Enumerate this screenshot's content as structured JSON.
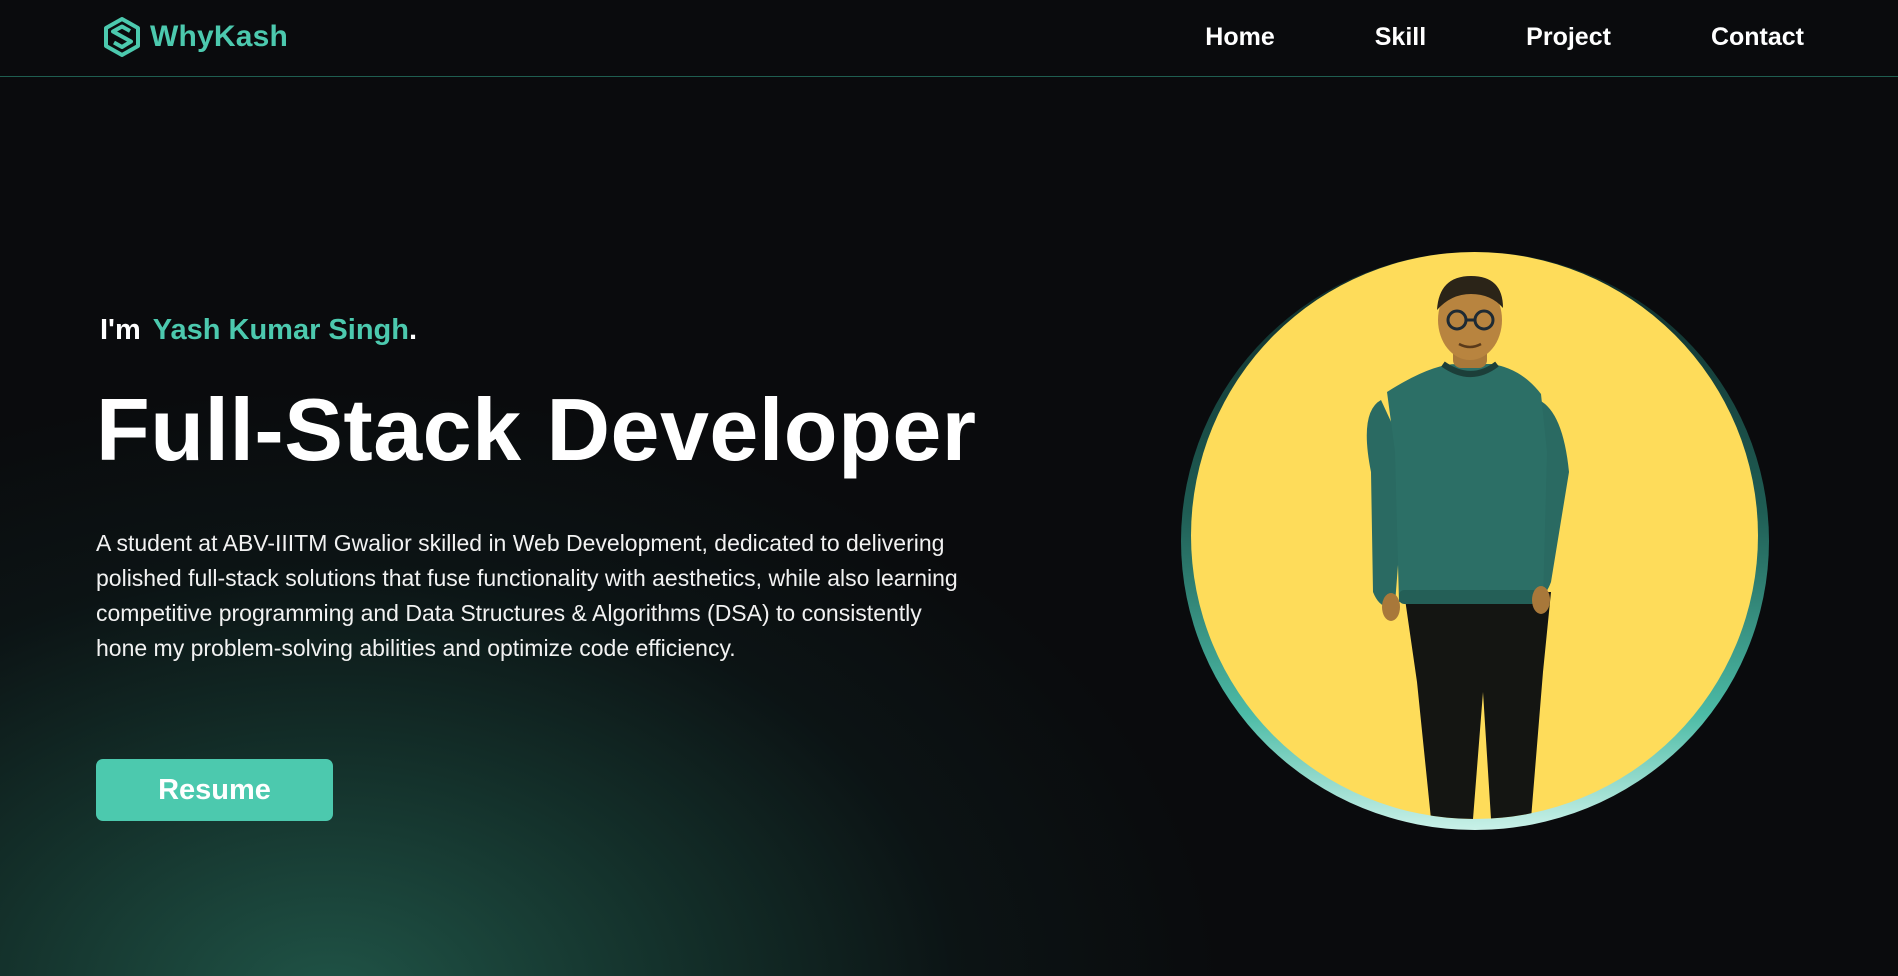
{
  "header": {
    "brand": "WhyKash",
    "nav": [
      {
        "label": "Home"
      },
      {
        "label": "Skill"
      },
      {
        "label": "Project"
      },
      {
        "label": "Contact"
      }
    ]
  },
  "hero": {
    "intro_prefix": "I'm",
    "name": "Yash Kumar Singh",
    "name_suffix": ".",
    "title": "Full-Stack Developer",
    "description": "A student at ABV-IIITM Gwalior skilled in Web Development, dedicated to delivering polished full-stack solutions that fuse functionality with aesthetics, while also learning competitive programming and Data Structures & Algorithms (DSA) to consistently hone my problem-solving abilities and optimize code efficiency.",
    "resume_label": "Resume"
  },
  "icons": {
    "brand": "hexagon-s-logo-icon"
  },
  "colors": {
    "accent": "#4cc9ae",
    "background": "#0a0b0d",
    "avatar_background": "#fedc5a",
    "header_border": "#1f5e50"
  }
}
